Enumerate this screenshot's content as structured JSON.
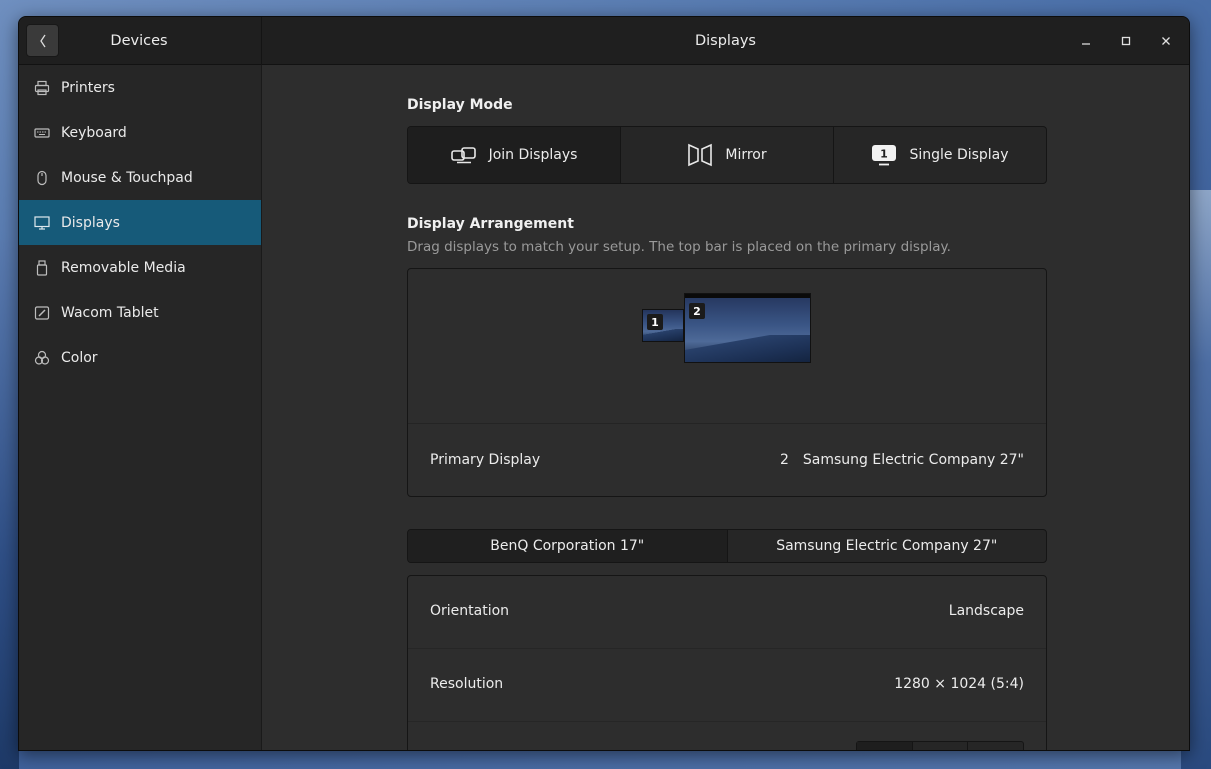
{
  "titlebar": {
    "left_title": "Devices",
    "main_title": "Displays",
    "back_icon": "chevron-left-icon",
    "controls": [
      "minimize",
      "maximize",
      "close"
    ]
  },
  "sidebar": {
    "items": [
      {
        "label": "Printers",
        "icon": "printer-icon"
      },
      {
        "label": "Keyboard",
        "icon": "keyboard-icon"
      },
      {
        "label": "Mouse & Touchpad",
        "icon": "mouse-icon"
      },
      {
        "label": "Displays",
        "icon": "display-icon",
        "active": true
      },
      {
        "label": "Removable Media",
        "icon": "usb-drive-icon"
      },
      {
        "label": "Wacom Tablet",
        "icon": "tablet-icon"
      },
      {
        "label": "Color",
        "icon": "color-icon"
      }
    ]
  },
  "display_mode": {
    "title": "Display Mode",
    "options": [
      {
        "label": "Join Displays",
        "icon": "join-displays-icon",
        "selected": true
      },
      {
        "label": "Mirror",
        "icon": "mirror-icon",
        "selected": false
      },
      {
        "label": "Single Display",
        "icon": "single-display-icon",
        "selected": false
      }
    ]
  },
  "arrangement": {
    "title": "Display Arrangement",
    "subtitle": "Drag displays to match your setup. The top bar is placed on the primary display.",
    "monitors": [
      {
        "number": "1"
      },
      {
        "number": "2"
      }
    ],
    "primary_label": "Primary Display",
    "primary_number": "2",
    "primary_name": "Samsung Electric Company 27\""
  },
  "display_tabs": [
    {
      "label": "BenQ Corporation 17\"",
      "selected": true
    },
    {
      "label": "Samsung Electric Company 27\"",
      "selected": false
    }
  ],
  "settings": {
    "orientation_label": "Orientation",
    "orientation_value": "Landscape",
    "resolution_label": "Resolution",
    "resolution_value": "1280 × 1024 (5:4)"
  },
  "colors": {
    "accent": "#165a79",
    "window_bg": "#2d2d2d",
    "sidebar_bg": "#262626",
    "titlebar_bg": "#1f1f1f"
  }
}
